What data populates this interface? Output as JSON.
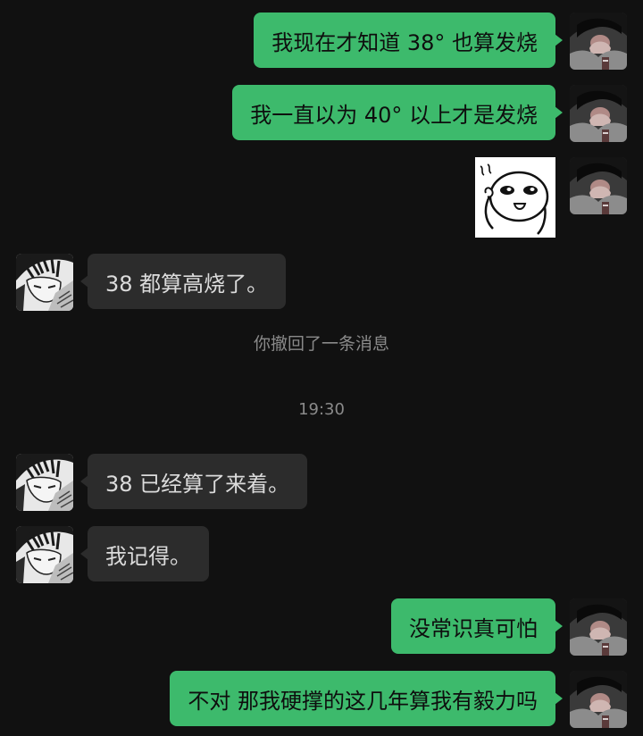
{
  "messages": {
    "m1": "我现在才知道 38° 也算发烧",
    "m2": "我一直以为 40° 以上才是发烧",
    "m4": "38 都算高烧了。",
    "m5": "38 已经算了来着。",
    "m6": "我记得。",
    "m7": "没常识真可怕",
    "m8": "不对 那我硬撑的这几年算我有毅力吗"
  },
  "system": {
    "recall_notice": "你撤回了一条消息",
    "timestamp": "19:30"
  },
  "icons": {
    "my_avatar": "dark-hair-avatar-icon",
    "their_avatar": "manga-avatar-icon",
    "sticker": "smiling-face-sticker"
  },
  "colors": {
    "background": "#111111",
    "my_bubble": "#3dba6c",
    "their_bubble": "#2c2c2c",
    "system_text": "#8a8a8a"
  }
}
